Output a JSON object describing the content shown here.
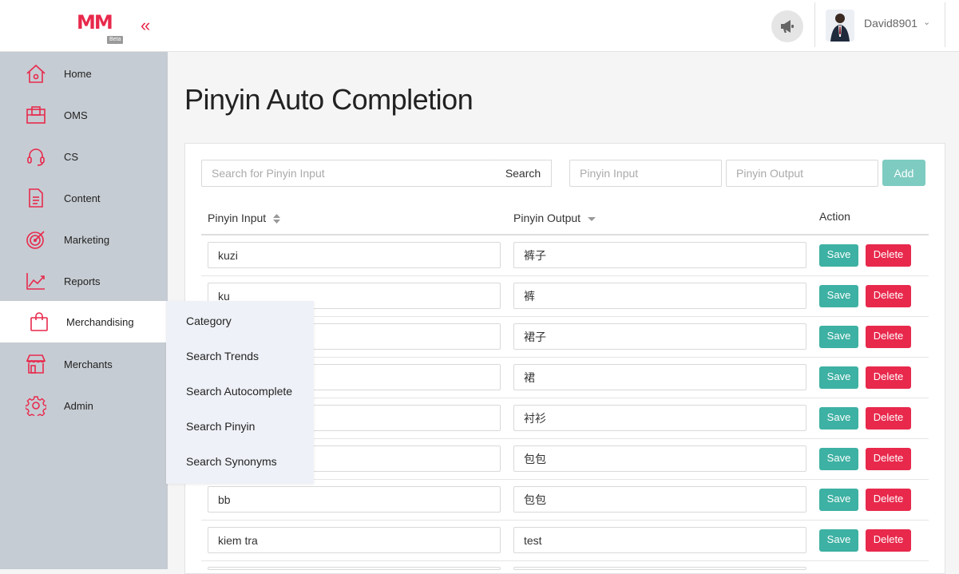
{
  "header": {
    "logo_text": "MM",
    "logo_badge": "Beta",
    "collapse_glyph": "«",
    "announce_icon": "megaphone-icon",
    "username": "David8901",
    "user_caret": "⌄"
  },
  "sidebar": {
    "items": [
      {
        "label": "Home",
        "icon": "home-icon"
      },
      {
        "label": "OMS",
        "icon": "box-icon"
      },
      {
        "label": "CS",
        "icon": "headset-icon"
      },
      {
        "label": "Content",
        "icon": "document-icon"
      },
      {
        "label": "Marketing",
        "icon": "target-icon"
      },
      {
        "label": "Reports",
        "icon": "chart-icon"
      },
      {
        "label": "Merchandising",
        "icon": "shopping-bag-icon",
        "active": true
      },
      {
        "label": "Merchants",
        "icon": "store-icon"
      },
      {
        "label": "Admin",
        "icon": "gear-icon"
      }
    ],
    "flyout": [
      "Category",
      "Search Trends",
      "Search Autocomplete",
      "Search Pinyin",
      "Search Synonyms"
    ]
  },
  "main": {
    "title": "Pinyin Auto Completion",
    "search_placeholder": "Search for Pinyin Input",
    "search_button": "Search",
    "new_input_placeholder": "Pinyin Input",
    "new_output_placeholder": "Pinyin Output",
    "add_button": "Add",
    "columns": [
      "Pinyin Input",
      "Pinyin Output",
      "Action"
    ],
    "save_label": "Save",
    "delete_label": "Delete",
    "rows": [
      {
        "input": "kuzi",
        "output": "裤子"
      },
      {
        "input": "ku",
        "output": "裤"
      },
      {
        "input": "",
        "output": "裙子"
      },
      {
        "input": "",
        "output": "裙"
      },
      {
        "input": "",
        "output": "衬衫"
      },
      {
        "input": "",
        "output": "包包"
      },
      {
        "input": "bb",
        "output": "包包"
      },
      {
        "input": "kiem tra",
        "output": "test"
      }
    ]
  },
  "colors": {
    "brand": "#e8294c",
    "save": "#3db1a3",
    "add": "#7ecbc1",
    "sidebar": "#c6ccd3",
    "flyout": "#eef1f7"
  }
}
